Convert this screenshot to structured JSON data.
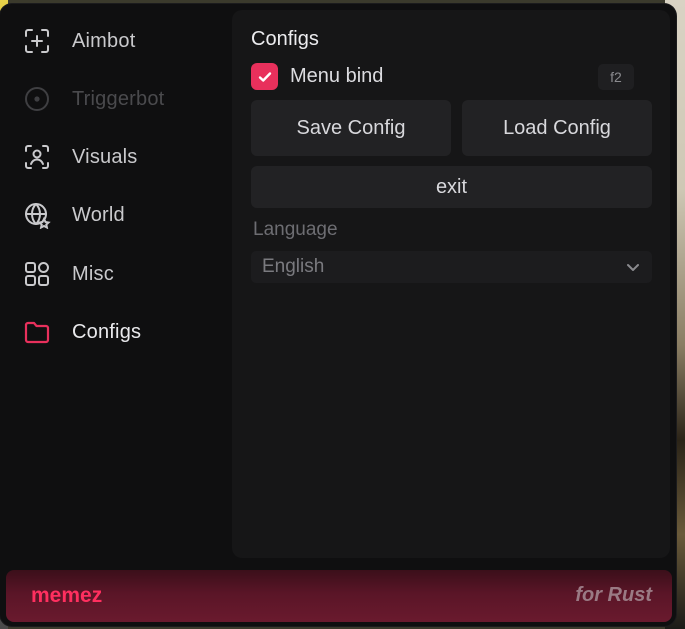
{
  "sidebar": {
    "items": [
      {
        "label": "Aimbot",
        "icon": "crosshair-plus-icon",
        "state": "normal"
      },
      {
        "label": "Triggerbot",
        "icon": "circle-dot-icon",
        "state": "disabled"
      },
      {
        "label": "Visuals",
        "icon": "face-scan-icon",
        "state": "normal"
      },
      {
        "label": "World",
        "icon": "globe-icon",
        "state": "normal"
      },
      {
        "label": "Misc",
        "icon": "grid-icon",
        "state": "normal"
      },
      {
        "label": "Configs",
        "icon": "folder-icon",
        "state": "active"
      }
    ]
  },
  "panel": {
    "title": "Configs",
    "menu_bind": {
      "label": "Menu bind",
      "checked": true,
      "key": "f2"
    },
    "save_label": "Save Config",
    "load_label": "Load Config",
    "exit_label": "exit",
    "language": {
      "label": "Language",
      "value": "English"
    }
  },
  "footer": {
    "brand": "memez",
    "tagline": "for Rust"
  },
  "colors": {
    "accent": "#e8305c",
    "background": "#0f0f10",
    "panel": "#161617",
    "button": "#222224"
  }
}
